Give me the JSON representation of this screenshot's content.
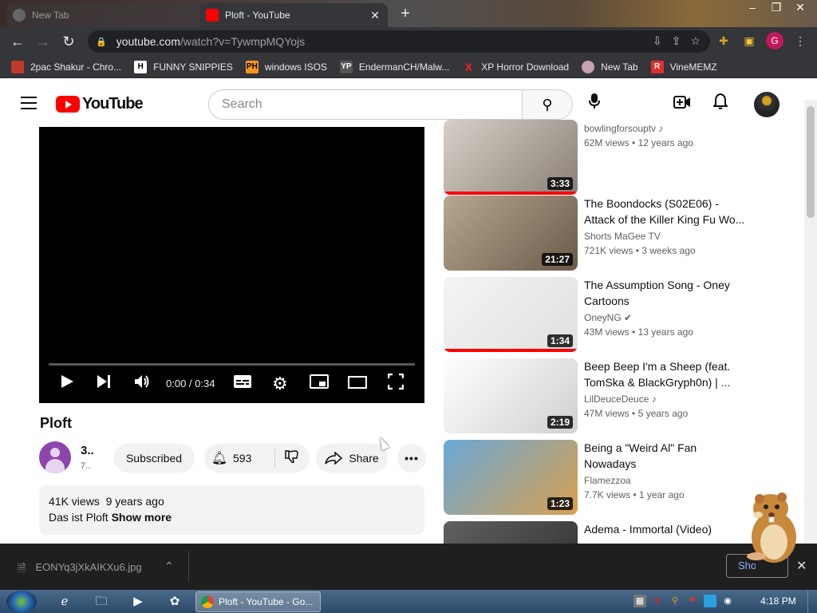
{
  "browser": {
    "tabs": [
      {
        "title": "New Tab",
        "active": false
      },
      {
        "title": "Ploft - YouTube",
        "active": true
      }
    ],
    "url_host": "youtube.com",
    "url_path": "/watch?v=TywmpMQYojs",
    "profile_initial": "G",
    "bookmarks": [
      {
        "label": "2pac Shakur - Chro...",
        "icon": "bookmark-favicon"
      },
      {
        "label": "FUNNY SNIPPIES",
        "icon": "H"
      },
      {
        "label": "windows ISOS",
        "icon": "PH"
      },
      {
        "label": "EndermanCH/Malw...",
        "icon": "YP"
      },
      {
        "label": "XP Horror Download",
        "icon": "X"
      },
      {
        "label": "New Tab",
        "icon": "globe"
      },
      {
        "label": "VineMEMZ",
        "icon": "R"
      }
    ]
  },
  "youtube": {
    "logo_text": "YouTube",
    "search_placeholder": "Search",
    "player": {
      "time": "0:00 / 0:34"
    },
    "video": {
      "title": "Ploft",
      "channel_name": "3..",
      "channel_subs": "7..",
      "subscribe_label": "Subscribed",
      "likes": "593",
      "share_label": "Share",
      "views": "41K views",
      "age": "9 years ago",
      "description": "Das ist Ploft",
      "show_more": "Show more"
    },
    "suggestions": [
      {
        "title": "",
        "channel": "bowlingforsouptv",
        "music": true,
        "verified": false,
        "views": "62M views",
        "age": "12 years ago",
        "duration": "3:33",
        "watched": 1.0,
        "thumb_colors": [
          "#d8d0c8",
          "#8a8078"
        ]
      },
      {
        "title": "The Boondocks (S02E06) - Attack of the Killer King Fu Wo...",
        "channel": "Shorts MaGee TV",
        "music": false,
        "verified": false,
        "views": "721K views",
        "age": "3 weeks ago",
        "duration": "21:27",
        "watched": 0,
        "thumb_colors": [
          "#b8a890",
          "#6a5a4a"
        ]
      },
      {
        "title": "The Assumption Song - Oney Cartoons",
        "channel": "OneyNG",
        "music": false,
        "verified": true,
        "views": "43M views",
        "age": "13 years ago",
        "duration": "1:34",
        "watched": 1.0,
        "thumb_colors": [
          "#f4f4f4",
          "#e0e0e0"
        ]
      },
      {
        "title": "Beep Beep I'm a Sheep (feat. TomSka & BlackGryph0n) | ...",
        "channel": "LilDeuceDeuce",
        "music": true,
        "verified": false,
        "views": "47M views",
        "age": "5 years ago",
        "duration": "2:19",
        "watched": 0,
        "thumb_colors": [
          "#ffffff",
          "#d0d0d0"
        ]
      },
      {
        "title": "Being a \"Weird Al\" Fan Nowadays",
        "channel": "Flamezzoa",
        "music": false,
        "verified": false,
        "views": "7.7K views",
        "age": "1 year ago",
        "duration": "1:23",
        "watched": 0,
        "thumb_colors": [
          "#6aa8d8",
          "#d8a050"
        ]
      },
      {
        "title": "Adema - Immortal (Video)",
        "channel": "",
        "music": false,
        "verified": false,
        "views": "",
        "age": "",
        "duration": "",
        "watched": 0,
        "thumb_colors": [
          "#606060",
          "#303030"
        ]
      }
    ]
  },
  "downloads": {
    "file": "EONYq3jXkAIKXu6.jpg",
    "show_all": "Show all"
  },
  "taskbar": {
    "active_app": "Ploft - YouTube - Go...",
    "clock": "4:18 PM"
  }
}
